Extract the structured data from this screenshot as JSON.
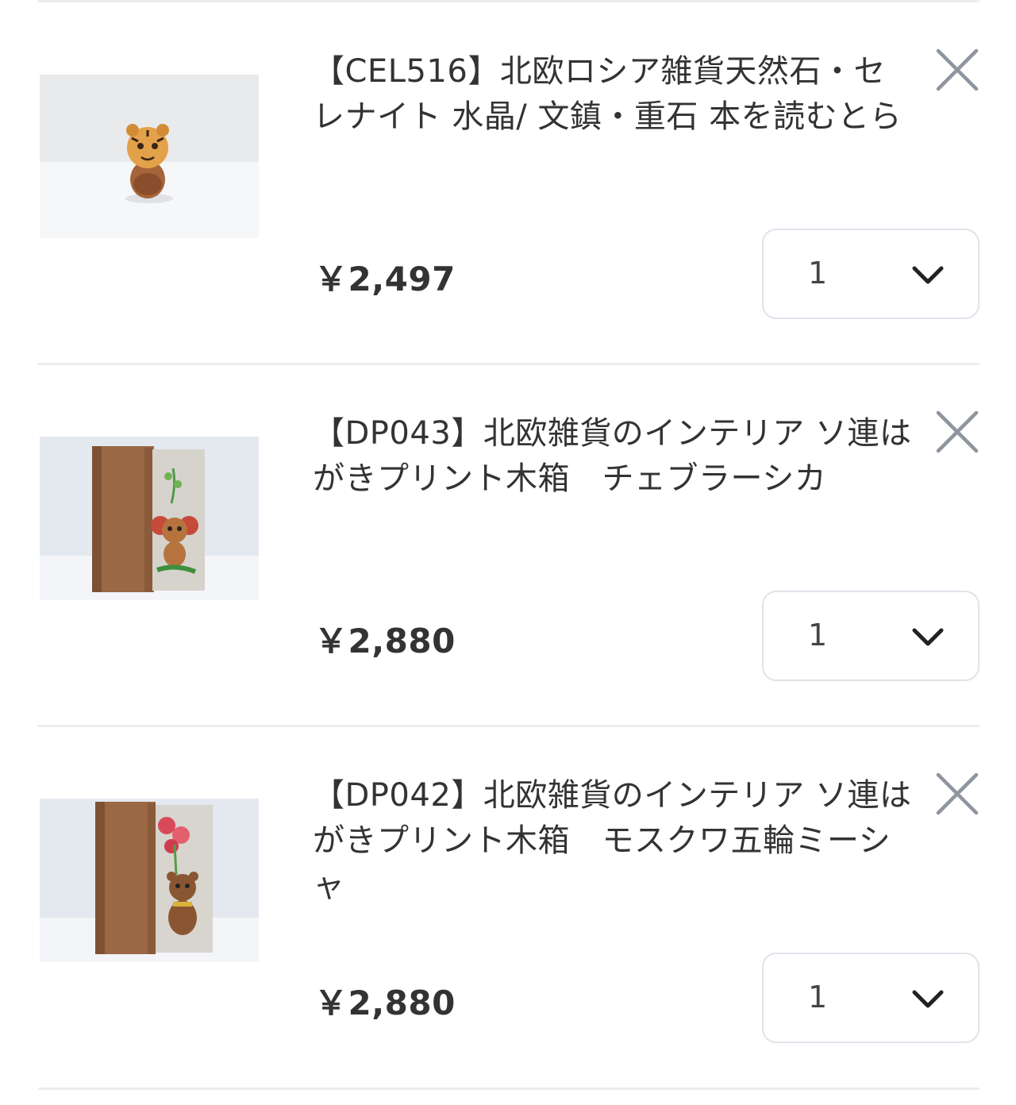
{
  "cart": {
    "items": [
      {
        "title": "【CEL516】北欧ロシア雑貨天然石・セレナイト 水晶/ 文鎮・重石 本を読むとら",
        "price": "￥2,497",
        "quantity": "1",
        "thumbnail_icon": "tiger-figurine-photo"
      },
      {
        "title": "【DP043】北欧雑貨のインテリア ソ連はがきプリント木箱　チェブラーシカ",
        "price": "￥2,880",
        "quantity": "1",
        "thumbnail_icon": "wooden-box-cheburashka-photo"
      },
      {
        "title": "【DP042】北欧雑貨のインテリア ソ連はがきプリント木箱　モスクワ五輪ミーシャ",
        "price": "￥2,880",
        "quantity": "1",
        "thumbnail_icon": "wooden-box-misha-photo"
      }
    ],
    "remove_icon": "close-icon",
    "dropdown_icon": "chevron-down-icon"
  }
}
